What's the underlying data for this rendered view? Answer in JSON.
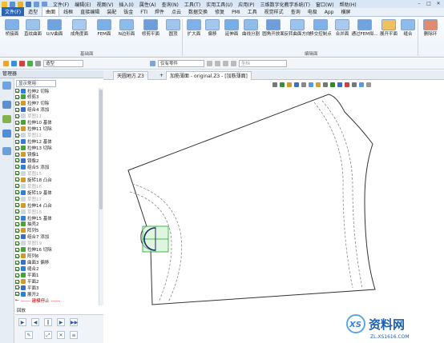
{
  "menu": {
    "items": [
      "文件(F)",
      "编辑(E)",
      "视图(V)",
      "插入(I)",
      "属性(A)",
      "查询(N)",
      "工具(T)",
      "实用工具(U)",
      "应用(P)",
      "三维数字化教学系统(T)",
      "窗口(W)",
      "帮助(H)"
    ]
  },
  "ribbon_tabs": [
    "文件(F)",
    "造型",
    "曲面",
    "线框",
    "直接编辑",
    "装配",
    "钣金",
    "FTI",
    "焊件",
    "点云",
    "数据交换",
    "修复",
    "PMI",
    "工具",
    "视觉样式",
    "查询",
    "电极",
    "App",
    "横屏"
  ],
  "ribbon": {
    "buttons": [
      "桥接面",
      "直纹曲面",
      "U/V曲面",
      "成角度面",
      "FEM面",
      "N边形面",
      "修剪平面",
      "圆顶",
      "扩大面",
      "偏移",
      "延伸面",
      "曲线分割",
      "圆角开放面",
      "反转曲面方向",
      "移交控制点",
      "合并面",
      "通过FEM拟...",
      "展开平面",
      "缝合",
      "删除环"
    ],
    "groups": [
      "基础面",
      "编辑面"
    ]
  },
  "toolbar": {
    "mode_combo": "造型",
    "filter_combo": "仅有零件",
    "input_placeholder": "坐标"
  },
  "manager": {
    "title": "管理器",
    "combo": "显示常用",
    "tree": [
      {
        "label": "拉伸2 切除",
        "state": "on"
      },
      {
        "label": "修剪3",
        "state": "on"
      },
      {
        "label": "拉伸7 切除",
        "state": "on"
      },
      {
        "label": "组合4 添加",
        "state": "on"
      },
      {
        "label": "草图11",
        "state": "off"
      },
      {
        "label": "拉伸10 基体",
        "state": "on"
      },
      {
        "label": "拉伸11 切除",
        "state": "on"
      },
      {
        "label": "草图12",
        "state": "off"
      },
      {
        "label": "拉伸12 基体",
        "state": "on"
      },
      {
        "label": "拉伸13 切除",
        "state": "on"
      },
      {
        "label": "镜像1",
        "state": "on"
      },
      {
        "label": "镜像2",
        "state": "on"
      },
      {
        "label": "组合5 添加",
        "state": "on"
      },
      {
        "label": "草图15",
        "state": "off"
      },
      {
        "label": "旋转18 凸台",
        "state": "on"
      },
      {
        "label": "草图16",
        "state": "off"
      },
      {
        "label": "旋转19 基体",
        "state": "on"
      },
      {
        "label": "草图17",
        "state": "off"
      },
      {
        "label": "拉伸14 凸台",
        "state": "on"
      },
      {
        "label": "草图18",
        "state": "off"
      },
      {
        "label": "拉伸15 基体",
        "state": "on"
      },
      {
        "label": "抽壳2",
        "state": "on"
      },
      {
        "label": "阵列5",
        "state": "on"
      },
      {
        "label": "组合7 添加",
        "state": "on"
      },
      {
        "label": "草图19",
        "state": "off"
      },
      {
        "label": "拉伸16 切除",
        "state": "on"
      },
      {
        "label": "阵列6",
        "state": "on"
      },
      {
        "label": "曲面3 偏移",
        "state": "on"
      },
      {
        "label": "缝合2",
        "state": "on"
      },
      {
        "label": "平面1",
        "state": "on"
      },
      {
        "label": "平面2",
        "state": "on"
      },
      {
        "label": "平面3",
        "state": "on"
      },
      {
        "label": "展开2",
        "state": "on"
      },
      {
        "label": "------ 建模停止 ------",
        "state": "stop"
      }
    ]
  },
  "playback": {
    "title": "回放"
  },
  "doc_tabs": [
    "天圆地方.Z3",
    "+",
    "加筋薄面 - original.Z3 - [加筋薄面]"
  ],
  "watermark": {
    "brand": "资料网",
    "url": "ZL.XS1616.COM"
  },
  "colors": {
    "accent": "#2b66b6",
    "tree_check": "#2e8b22",
    "stop_red": "#cc0000",
    "grid_green": "#1aa531"
  }
}
